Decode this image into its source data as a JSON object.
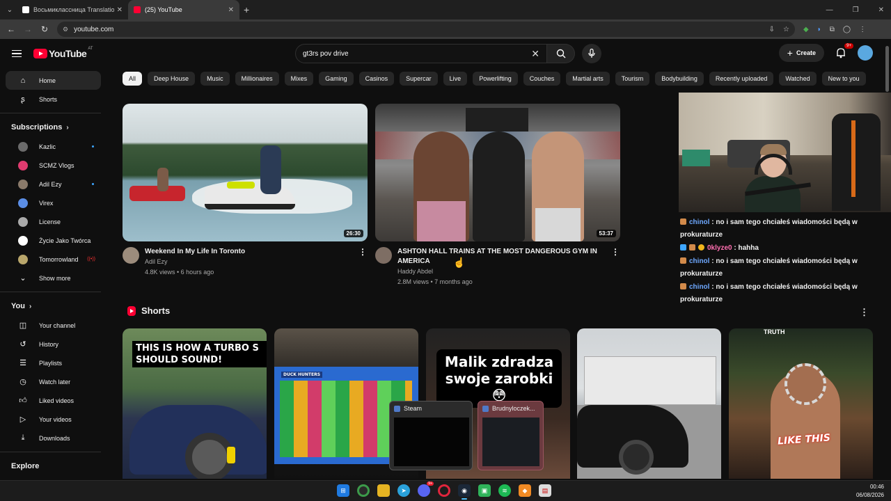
{
  "browser": {
    "tabs": [
      {
        "title": "Восьмиклассница Translation",
        "color": "#ffffff"
      },
      {
        "title": "(25) YouTube",
        "color": "#ff0033"
      }
    ],
    "url": "youtube.com"
  },
  "header": {
    "logo_text": "YouTube",
    "logo_country": "AT",
    "search_value": "gt3rs pov drive",
    "create_label": "Create",
    "notification_badge": "9+"
  },
  "sidebar": {
    "main": [
      {
        "label": "Home",
        "icon": "home-icon"
      },
      {
        "label": "Shorts",
        "icon": "shorts-icon"
      }
    ],
    "subscriptions_title": "Subscriptions",
    "subscriptions": [
      {
        "label": "Kazlic",
        "color": "#6b6b6b",
        "dot": true
      },
      {
        "label": "SCMZ Vlogs",
        "color": "#e03b6f",
        "dot": false
      },
      {
        "label": "Adil Ezy",
        "color": "#8a7a6a",
        "dot": true
      },
      {
        "label": "Virex",
        "color": "#5b8ee6",
        "dot": false
      },
      {
        "label": "License",
        "color": "#aaaaaa",
        "dot": false
      },
      {
        "label": "Życie Jako Twórca",
        "color": "#ffffff",
        "dot": false
      },
      {
        "label": "Tomorrowland",
        "color": "#b9a66b",
        "dot": false,
        "live": true
      }
    ],
    "show_more": "Show more",
    "you_title": "You",
    "you_items": [
      {
        "label": "Your channel",
        "icon": "channel-icon"
      },
      {
        "label": "History",
        "icon": "history-icon"
      },
      {
        "label": "Playlists",
        "icon": "playlists-icon"
      },
      {
        "label": "Watch later",
        "icon": "watch-later-icon"
      },
      {
        "label": "Liked videos",
        "icon": "like-icon"
      },
      {
        "label": "Your videos",
        "icon": "your-videos-icon"
      },
      {
        "label": "Downloads",
        "icon": "download-icon"
      }
    ],
    "explore_title": "Explore"
  },
  "chips": [
    "All",
    "Deep House",
    "Music",
    "Millionaires",
    "Mixes",
    "Gaming",
    "Casinos",
    "Supercar",
    "Live",
    "Powerlifting",
    "Couches",
    "Martial arts",
    "Tourism",
    "Bodybuilding",
    "Recently uploaded",
    "Watched",
    "New to you"
  ],
  "videos": [
    {
      "title": "Weekend In My Life In Toronto",
      "channel": "Adil Ezy",
      "stats": "4.8K views • 6 hours ago",
      "duration": "26:30"
    },
    {
      "title": "ASHTON HALL TRAINS AT THE MOST DANGEROUS GYM IN AMERICA",
      "channel": "Haddy Abdel",
      "stats": "2.8M views • 7 months ago",
      "duration": "53:37"
    }
  ],
  "chat": [
    {
      "user": "chinol",
      "msg": "no i sam tego chciałeś wiadomości będą w prokuraturze",
      "user_color": "#6ea8ff"
    },
    {
      "user": "0klyze0",
      "msg": "hahha",
      "user_color": "#ff6fb0"
    },
    {
      "user": "chinol",
      "msg": "no i sam tego chciałeś wiadomości będą w prokuraturze",
      "user_color": "#6ea8ff"
    },
    {
      "user": "chinol",
      "msg": "no i sam tego chciałeś wiadomości będą w prokuraturze",
      "user_color": "#6ea8ff"
    }
  ],
  "shorts": {
    "title": "Shorts",
    "items": [
      {
        "caption": "THIS IS HOW A TURBO S SHOULD SOUND!"
      },
      {
        "caption": "DUCK HUNTERS"
      },
      {
        "caption": "Malik zdradza swoje zarobki 😳"
      },
      {
        "caption": ""
      },
      {
        "caption": "LIKE THIS",
        "top_text": "TRUTH"
      }
    ]
  },
  "previews": [
    {
      "title": "Steam"
    },
    {
      "title": "Brudnyloczek..."
    }
  ],
  "taskbar": {
    "time": "00:46",
    "date": "06/08/2026",
    "discord_badge": "9+"
  }
}
